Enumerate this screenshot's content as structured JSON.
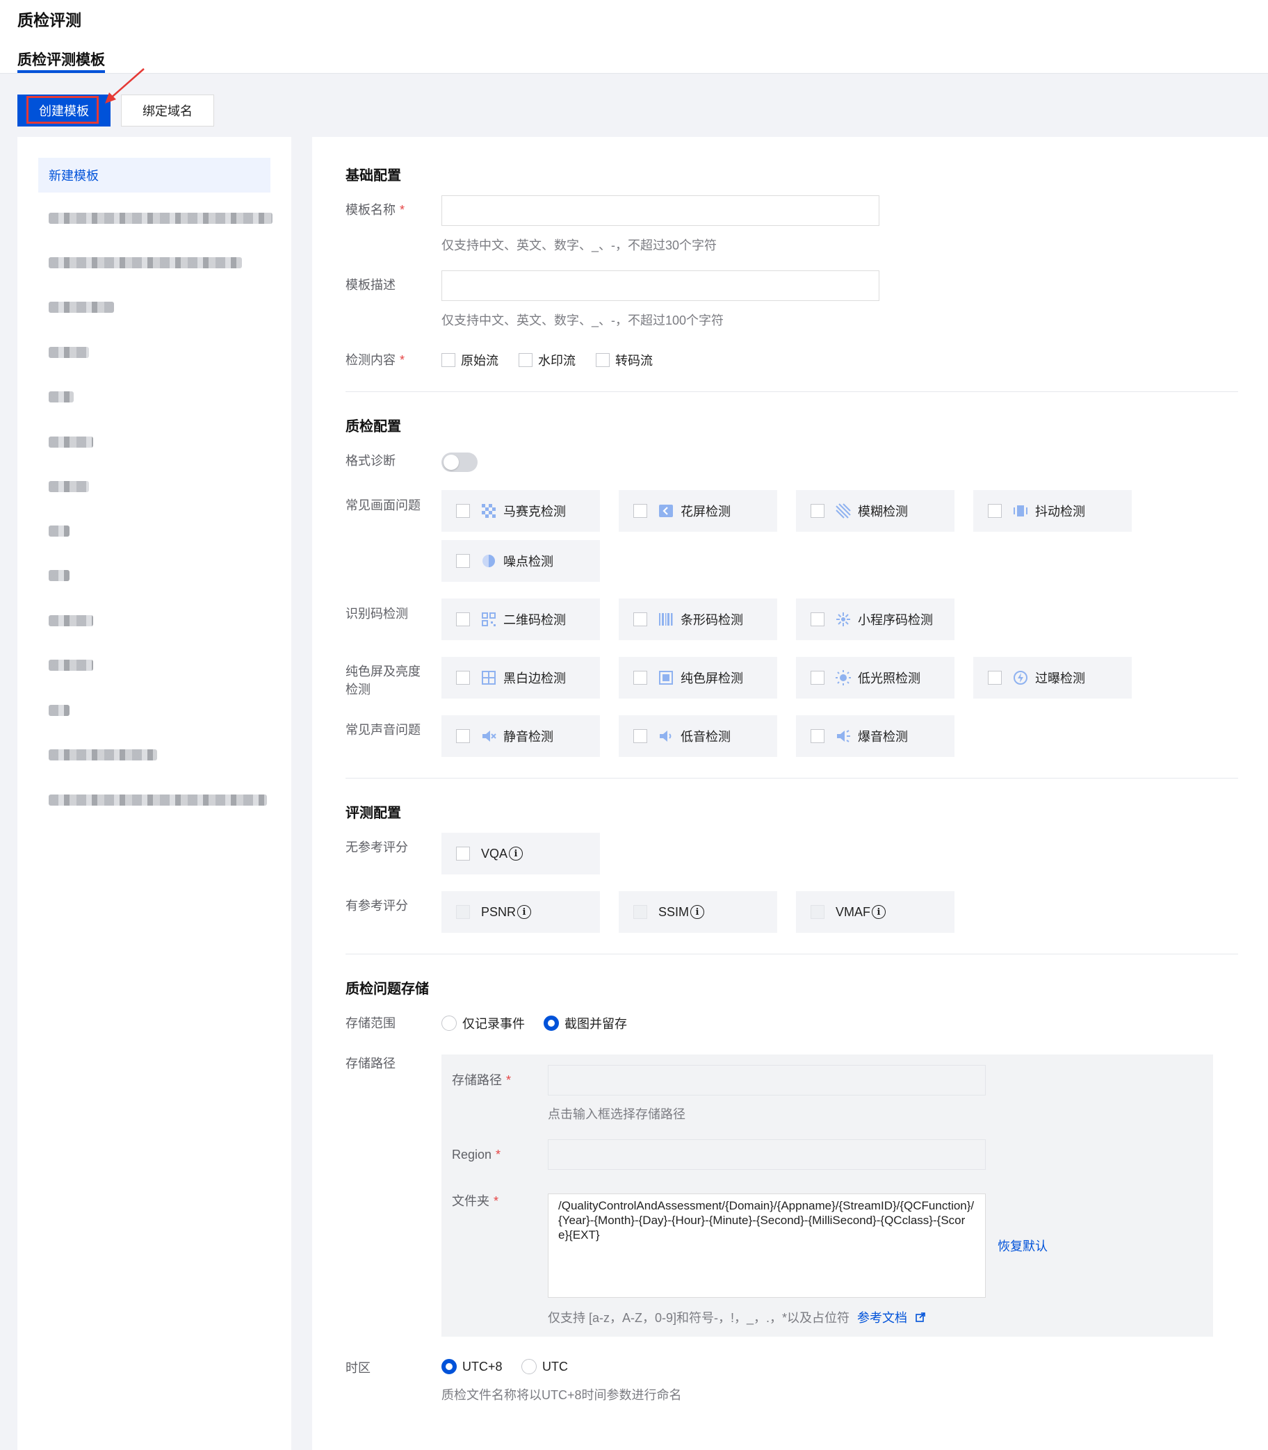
{
  "header": {
    "title": "质检评测",
    "sub_tab": "质检评测模板"
  },
  "toolbar": {
    "create_label": "创建模板",
    "bind_label": "绑定域名"
  },
  "sidebar": {
    "active_item": "新建模板"
  },
  "basic": {
    "section_title": "基础配置",
    "name_label": "模板名称",
    "name_hint": "仅支持中文、英文、数字、_、-，不超过30个字符",
    "desc_label": "模板描述",
    "desc_hint": "仅支持中文、英文、数字、_、-，不超过100个字符",
    "content_label": "检测内容",
    "content_options": [
      "原始流",
      "水印流",
      "转码流"
    ],
    "required_mark": "*"
  },
  "qc": {
    "section_title": "质检配置",
    "format_label": "格式诊断",
    "format_enabled": false,
    "picture_label": "常见画面问题",
    "picture_items": [
      "马赛克检测",
      "花屏检测",
      "模糊检测",
      "抖动检测",
      "噪点检测"
    ],
    "code_label": "识别码检测",
    "code_items": [
      "二维码检测",
      "条形码检测",
      "小程序码检测"
    ],
    "solid_label_line1": "纯色屏及亮度",
    "solid_label_line2": "检测",
    "solid_items": [
      "黑白边检测",
      "纯色屏检测",
      "低光照检测",
      "过曝检测"
    ],
    "audio_label": "常见声音问题",
    "audio_items": [
      "静音检测",
      "低音检测",
      "爆音检测"
    ]
  },
  "eval": {
    "section_title": "评测配置",
    "noref_label": "无参考评分",
    "noref_items": [
      "VQA"
    ],
    "ref_label": "有参考评分",
    "ref_items": [
      "PSNR",
      "SSIM",
      "VMAF"
    ],
    "info_glyph": "i"
  },
  "storage": {
    "section_title": "质检问题存储",
    "scope_label": "存储范围",
    "scope_options": [
      "仅记录事件",
      "截图并留存"
    ],
    "scope_selected": "截图并留存",
    "path_label": "存储路径",
    "inner_path_label": "存储路径",
    "path_hint": "点击输入框选择存储路径",
    "region_label": "Region",
    "folder_label": "文件夹",
    "folder_value": "/QualityControlAndAssessment/{Domain}/{Appname}/{StreamID}/{QCFunction}/{Year}-{Month}-{Day}-{Hour}-{Minute}-{Second}-{MilliSecond}-{QCclass}-{Score}{EXT}",
    "restore_label": "恢复默认",
    "folder_hint": "仅支持 [a-z，A-Z，0-9]和符号-，!，_，.，*以及占位符",
    "doc_link": "参考文档"
  },
  "timezone": {
    "label": "时区",
    "options": [
      "UTC+8",
      "UTC"
    ],
    "selected": "UTC+8",
    "hint": "质检文件名称将以UTC+8时间参数进行命名"
  },
  "colors": {
    "primary": "#0052d9",
    "required": "#e54545",
    "highlight": "#e53935"
  }
}
